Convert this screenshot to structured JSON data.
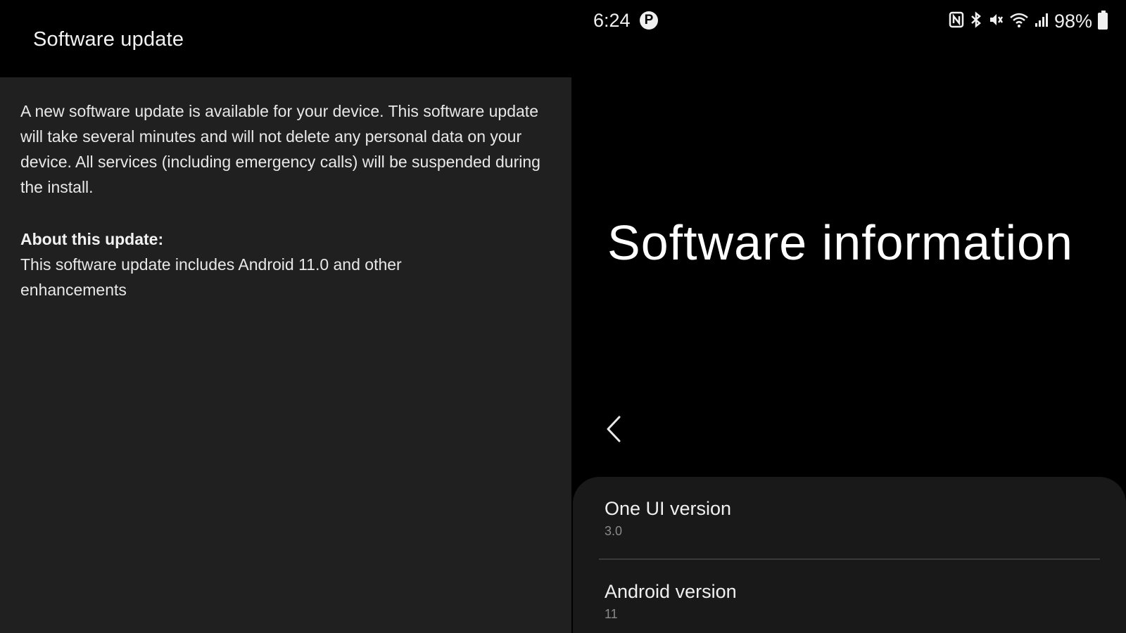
{
  "left": {
    "header_title": "Software update",
    "description": "A new software update is available for your device. This software update will take several minutes and will not delete any personal data on your device. All services (including emergency calls) will be suspended during the install.",
    "about_heading": "About this update:",
    "about_text": "This software update includes Android 11.0 and other enhancements"
  },
  "right": {
    "status_bar": {
      "time": "6:24",
      "p_icon_label": "P",
      "battery_percent": "98%",
      "icons": [
        "nfc-icon",
        "bluetooth-icon",
        "mute-icon",
        "wifi-icon",
        "signal-icon",
        "battery-icon"
      ]
    },
    "page_title": "Software information",
    "items": [
      {
        "title": "One UI version",
        "value": "3.0"
      },
      {
        "title": "Android version",
        "value": "11"
      }
    ]
  }
}
